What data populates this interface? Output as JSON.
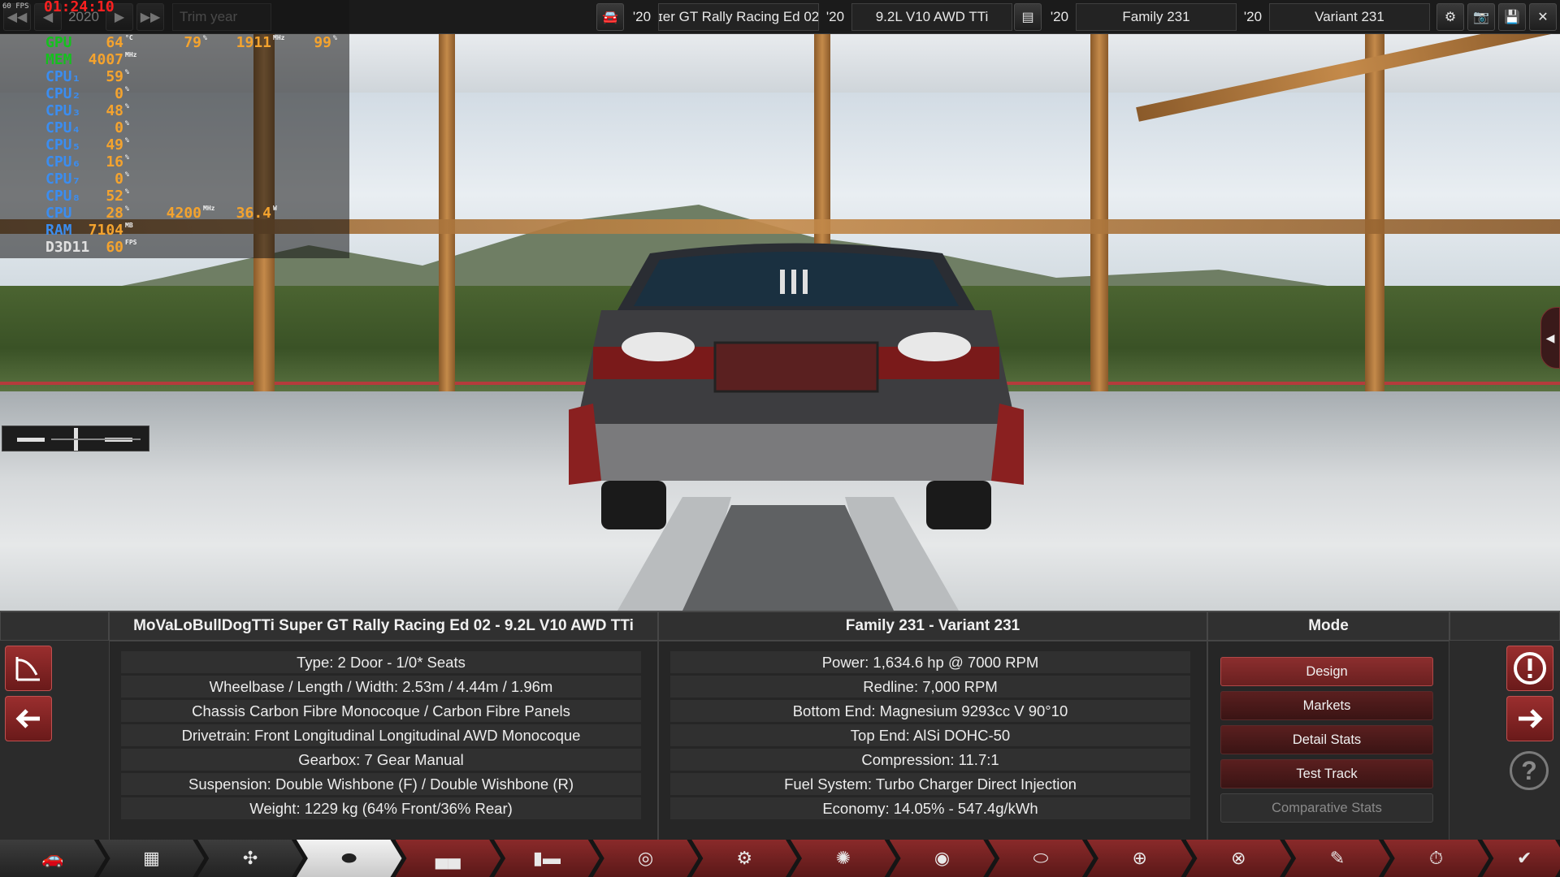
{
  "topbar": {
    "year_value": "2020",
    "trim_year_label": "Trim year",
    "model_year": "'20",
    "model_name": "ɪer GT Rally Racing Ed 02",
    "engine_year": "'20",
    "engine_name": "9.2L V10 AWD TTi",
    "family_year": "'20",
    "family_name": "Family 231",
    "variant_year": "'20",
    "variant_name": "Variant 231"
  },
  "osd": {
    "fps_small": "60 FPS",
    "clock": "01:24:10",
    "rows": [
      {
        "label": "GPU",
        "color": "green",
        "v1": "64",
        "u1": "°C",
        "v2": "79",
        "u2": "%",
        "v3": "1911",
        "u3": "MHz",
        "v4": "99",
        "u4": "%"
      },
      {
        "label": "MEM",
        "color": "green",
        "v1": "4007",
        "u1": "MHz"
      },
      {
        "label": "CPU₁",
        "color": "blue",
        "v1": "59",
        "u1": "%"
      },
      {
        "label": "CPU₂",
        "color": "blue",
        "v1": "0",
        "u1": "%"
      },
      {
        "label": "CPU₃",
        "color": "blue",
        "v1": "48",
        "u1": "%"
      },
      {
        "label": "CPU₄",
        "color": "blue",
        "v1": "0",
        "u1": "%"
      },
      {
        "label": "CPU₅",
        "color": "blue",
        "v1": "49",
        "u1": "%"
      },
      {
        "label": "CPU₆",
        "color": "blue",
        "v1": "16",
        "u1": "%"
      },
      {
        "label": "CPU₇",
        "color": "blue",
        "v1": "0",
        "u1": "%"
      },
      {
        "label": "CPU₈",
        "color": "blue",
        "v1": "52",
        "u1": "%"
      },
      {
        "label": "CPU",
        "color": "blue",
        "v1": "28",
        "u1": "%",
        "v2": "4200",
        "u2": "MHz",
        "v3": "36.4",
        "u3": "W"
      },
      {
        "label": "RAM",
        "color": "blue",
        "v1": "7104",
        "u1": "MB"
      },
      {
        "label": "D3D11",
        "color": "white",
        "v1": "60",
        "u1": "FPS"
      }
    ]
  },
  "panel": {
    "car_title": "MoVaLoBullDogTTi Super GT Rally Racing Ed 02 - 9.2L V10 AWD TTi",
    "family_title": "Family 231 - Variant 231",
    "mode_title": "Mode",
    "car_stats": [
      "Type: 2 Door - 1/0* Seats",
      "Wheelbase / Length / Width: 2.53m / 4.44m / 1.96m",
      "Chassis Carbon Fibre Monocoque / Carbon Fibre Panels",
      "Drivetrain: Front Longitudinal Longitudinal AWD Monocoque",
      "Gearbox: 7 Gear Manual",
      "Suspension: Double Wishbone (F) / Double Wishbone (R)",
      "Weight: 1229 kg (64% Front/36% Rear)"
    ],
    "engine_stats": [
      "Power: 1,634.6 hp @ 7000 RPM",
      "Redline:  7,000 RPM",
      "Bottom End: Magnesium 9293cc V 90°10",
      "Top End: AlSi DOHC-50",
      "Compression: 11.7:1",
      "Fuel System: Turbo Charger Direct Injection",
      "Economy: 14.05% - 547.4g/kWh"
    ],
    "mode_buttons": [
      {
        "label": "Design",
        "state": "active"
      },
      {
        "label": "Markets",
        "state": "normal"
      },
      {
        "label": "Detail Stats",
        "state": "normal"
      },
      {
        "label": "Test Track",
        "state": "normal"
      },
      {
        "label": "Comparative Stats",
        "state": "disabled"
      }
    ],
    "help_glyph": "?"
  },
  "nav": [
    {
      "icon": "car-front-icon",
      "glyph": "🚗",
      "state": "normal"
    },
    {
      "icon": "chassis-icon",
      "glyph": "▦",
      "state": "normal"
    },
    {
      "icon": "suspension-icon",
      "glyph": "✣",
      "state": "normal"
    },
    {
      "icon": "body-icon",
      "glyph": "⬬",
      "state": "active"
    },
    {
      "icon": "trim-icon",
      "glyph": "▄▄",
      "state": "red"
    },
    {
      "icon": "fixtures-icon",
      "glyph": "▮▬",
      "state": "red"
    },
    {
      "icon": "engine-icon",
      "glyph": "◎",
      "state": "red"
    },
    {
      "icon": "gearbox-icon",
      "glyph": "⚙",
      "state": "red"
    },
    {
      "icon": "wheels-icon",
      "glyph": "✺",
      "state": "red"
    },
    {
      "icon": "brakes-icon",
      "glyph": "◉",
      "state": "red"
    },
    {
      "icon": "aero-icon",
      "glyph": "⬭",
      "state": "red"
    },
    {
      "icon": "interior-icon",
      "glyph": "⊕",
      "state": "red"
    },
    {
      "icon": "tuning-icon",
      "glyph": "⊗",
      "state": "red"
    },
    {
      "icon": "paint-icon",
      "glyph": "✎",
      "state": "red"
    },
    {
      "icon": "test-track-icon",
      "glyph": "⏱",
      "state": "red"
    },
    {
      "icon": "confirm-icon",
      "glyph": "✔",
      "state": "confirm"
    }
  ]
}
